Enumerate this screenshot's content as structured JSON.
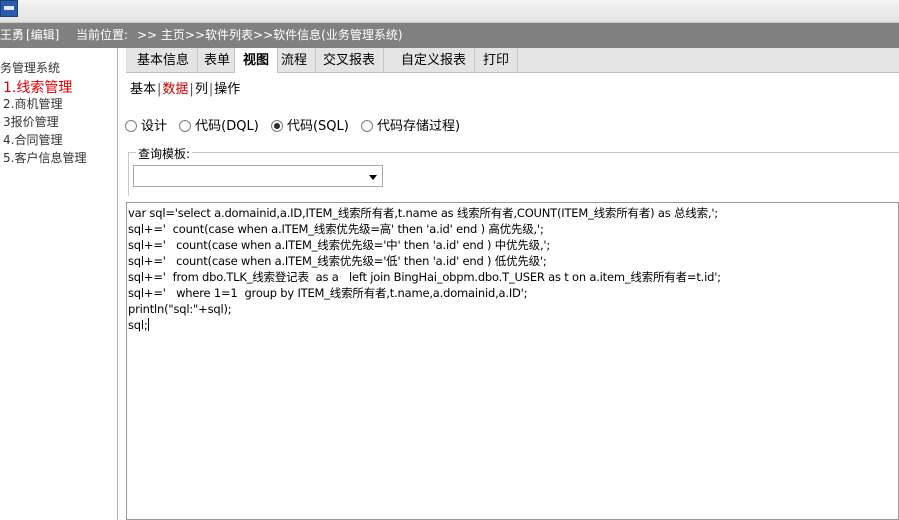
{
  "header": {
    "user": "王勇",
    "edit_label": "[编辑]",
    "location_label": "当前位置:",
    "location_path": ">> 主页>>软件列表>>软件信息(业务管理系统)"
  },
  "sidebar": {
    "system_name": "业务管理系统",
    "items": [
      {
        "label": "1.线索管理"
      },
      {
        "label": "2.商机管理"
      },
      {
        "label": "3报价管理"
      },
      {
        "label": "4.合同管理"
      },
      {
        "label": "5.客户信息管理"
      }
    ]
  },
  "tabs": [
    {
      "label": "基本信息"
    },
    {
      "label": "表单"
    },
    {
      "label": "视图"
    },
    {
      "label": "流程"
    },
    {
      "label": "交叉报表"
    },
    {
      "label": "自定义报表"
    },
    {
      "label": "打印"
    }
  ],
  "subtabs": [
    {
      "label": "基本"
    },
    {
      "label": "数据"
    },
    {
      "label": "列"
    },
    {
      "label": "操作"
    }
  ],
  "radios": [
    {
      "label": "设计",
      "checked": false
    },
    {
      "label": "代码(DQL)",
      "checked": false
    },
    {
      "label": "代码(SQL)",
      "checked": true
    },
    {
      "label": "代码存储过程)",
      "checked": false
    }
  ],
  "query_template": {
    "label": "查询模板:",
    "value": ""
  },
  "code": {
    "lines": [
      "var sql='select a.domainid,a.ID,ITEM_线索所有者,t.name as 线索所有者,COUNT(ITEM_线索所有者) as 总线索,';",
      "sql+='  count(case when a.ITEM_线索优先级=高' then 'a.id' end ) 高优先级,';",
      "sql+='   count(case when a.ITEM_线索优先级='中' then 'a.id' end ) 中优先级,';",
      "sql+='   count(case when a.ITEM_线索优先级='低' then 'a.id' end ) 低优先级';",
      "sql+='  from dbo.TLK_线索登记表  as a   left join BingHai_obpm.dbo.T_USER as t on a.item_线索所有者=t.id';",
      "sql+='   where 1=1  group by ITEM_线索所有者,t.name,a.domainid,a.ID';",
      "println(\"sql:\"+sql);",
      "sql;"
    ]
  }
}
